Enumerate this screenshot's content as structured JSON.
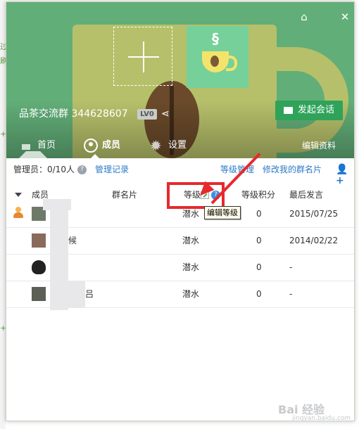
{
  "window": {
    "group_name": "品茶交流群",
    "group_id": "344628607",
    "level_badge": "LV0",
    "start_session": "发起会话",
    "edit_profile": "编辑资料"
  },
  "nav": {
    "home": "首页",
    "members": "成员",
    "settings": "设置"
  },
  "admin": {
    "count": "管理员：0/10人",
    "manage_log": "管理记录",
    "grade_manage": "等级管理",
    "edit_card": "修改我的群名片"
  },
  "table": {
    "headers": {
      "member": "成员",
      "card": "群名片",
      "grade": "等级",
      "score": "等级积分",
      "last": "最后发言"
    },
    "rows": [
      {
        "name": "",
        "grade": "潜水",
        "score": "0",
        "last": "2015/07/25"
      },
      {
        "name": "候",
        "grade": "潜水",
        "score": "0",
        "last": "2014/02/22"
      },
      {
        "name": "",
        "grade": "潜水",
        "score": "0",
        "last": "-"
      },
      {
        "name": "吕",
        "grade": "潜水",
        "score": "0",
        "last": "-"
      }
    ]
  },
  "tooltip": "编辑等级",
  "watermark": {
    "main": "Bai 经验",
    "sub": "jingyan.baidu.com"
  },
  "icons": {
    "skin": "skin-icon",
    "close": "close-icon",
    "share": "share-icon",
    "chat": "chat-icon",
    "home": "home-icon",
    "member": "member-icon",
    "settings": "gear-icon",
    "help": "help-icon",
    "add_user": "add-user-icon",
    "edit": "pencil-icon",
    "owner": "owner-icon"
  },
  "colors": {
    "banner": "#62ae78",
    "button": "#2fa35a",
    "link": "#2d79c7",
    "annotation": "#e6292e"
  }
}
